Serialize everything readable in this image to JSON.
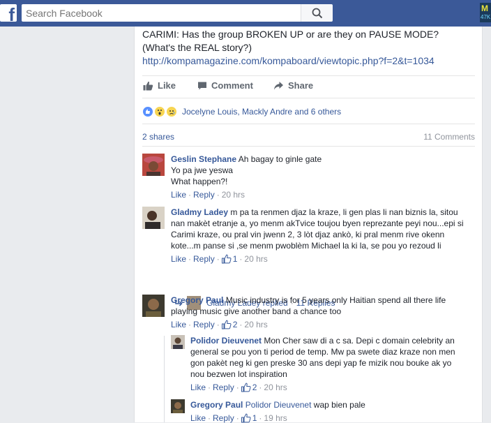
{
  "topbar": {
    "logo": "f",
    "search_placeholder": "Search Facebook",
    "ad_thumb_text_top": "M",
    "ad_thumb_text_bottom": "47K"
  },
  "post": {
    "text_line1": "CARIMI: Has the group BROKEN UP or are they on PAUSE MODE?",
    "text_line2": "(What's the REAL story?)",
    "link": "http://kompamagazine.com/kompaboard/viewtopic.php?f=2&t=1034",
    "actions": {
      "like": "Like",
      "comment": "Comment",
      "share": "Share"
    },
    "reactors": "Jocelyne Louis, Mackly Andre and 6 others",
    "shares": "2 shares",
    "comments_count": "11 Comments"
  },
  "comments": [
    {
      "author": "Geslin Stephane",
      "lines": [
        "Ah bagay to ginle gate",
        "Yo pa jwe yeswa",
        "What happen?!"
      ],
      "like": "Like",
      "reply": "Reply",
      "time": "20 hrs"
    },
    {
      "author": "Gladmy Ladey",
      "lines": [
        "m pa ta renmen djaz la kraze, li gen plas li nan biznis la, sitou",
        "nan makèt etranje a, yo menm akTvice toujou byen reprezante peyi nou...epi si",
        "Carimi kraze, ou pral vin jwenn 2, 3 lòt djaz ankò, ki pral menm rive okenn",
        "kote...m panse si ,se menm pwoblèm Michael la ki la, se pou yo rezoud li"
      ],
      "like": "Like",
      "reply": "Reply",
      "likes_count": "1",
      "time": "20 hrs",
      "replies_author": "Gladmy Ladey replied",
      "replies_count": "11 Replies"
    },
    {
      "author": "Gregory Paul",
      "lines": [
        "Music industry is for 5 years only Haitian spend all there life",
        "playing music give another band a chance too"
      ],
      "like": "Like",
      "reply": "Reply",
      "likes_count": "2",
      "time": "20 hrs"
    }
  ],
  "replies": [
    {
      "author": "Polidor Dieuvenet",
      "lines": [
        "Mon Cher saw di a c sa. Depi c domain celebrity an",
        "general se pou yon ti period de temp. Mw pa swete diaz kraze non men",
        "gon pakèt neg ki gen preske 30 ans depi yap fe mizik nou bouke ak yo",
        "nou bezwen lot inspiration"
      ],
      "like": "Like",
      "reply": "Reply",
      "likes_count": "2",
      "time": "20 hrs"
    },
    {
      "author": "Gregory Paul",
      "mention": "Polidor Dieuvenet",
      "text": "wap bien pale",
      "like": "Like",
      "reply": "Reply",
      "likes_count": "1",
      "time": "19 hrs"
    }
  ],
  "colors": {
    "topbar": "#3b5998",
    "link": "#365899",
    "background": "#e9ebee",
    "meta": "#90949c"
  }
}
